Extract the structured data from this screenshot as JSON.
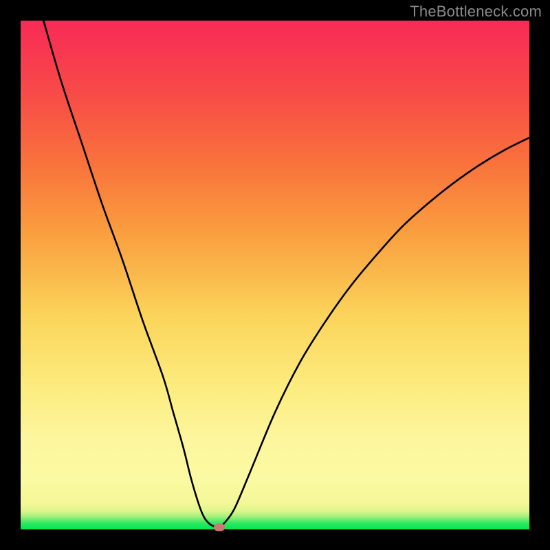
{
  "watermark": "TheBottleneck.com",
  "colors": {
    "frame": "#000000",
    "curve": "#000000",
    "marker": "#cb7a76",
    "gradient_top": "#f82a56",
    "gradient_bottom": "#00e852"
  },
  "chart_data": {
    "type": "line",
    "title": "",
    "xlabel": "",
    "ylabel": "",
    "xlim": [
      0,
      100
    ],
    "ylim": [
      0,
      100
    ],
    "x": [
      4.5,
      8,
      12,
      16,
      20,
      24,
      28,
      30,
      32,
      33.5,
      35,
      36,
      37,
      38,
      39,
      40,
      42,
      45,
      50,
      55,
      60,
      65,
      70,
      75,
      80,
      85,
      90,
      95,
      100
    ],
    "values": [
      100,
      88,
      76,
      64,
      53,
      41,
      30,
      23,
      16,
      10,
      5,
      2.5,
      1.2,
      0.6,
      0.4,
      1.2,
      4,
      11,
      23,
      33,
      41,
      48,
      54,
      59.5,
      64,
      68,
      71.5,
      74.5,
      77
    ],
    "marker": {
      "x": 39,
      "y": 0.4
    },
    "legend": false,
    "grid": false
  }
}
